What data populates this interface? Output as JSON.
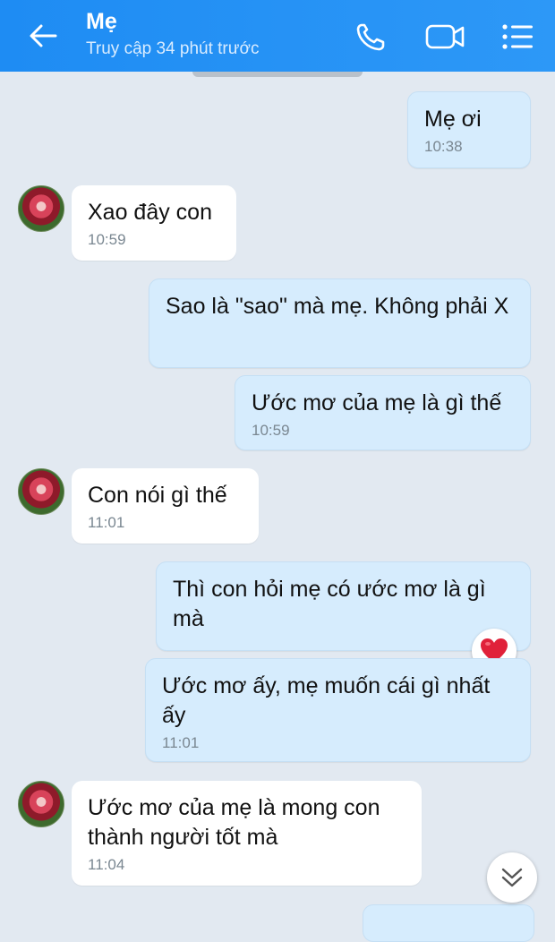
{
  "header": {
    "contact_name": "Mẹ",
    "status": "Truy cập 34 phút trước",
    "back_icon": "back-arrow-icon",
    "call_icon": "phone-icon",
    "video_icon": "video-camera-icon",
    "menu_icon": "list-menu-icon",
    "background": "#1e8cf3"
  },
  "messages": [
    {
      "sender": "me",
      "text": "Mẹ ơi",
      "time": "10:38"
    },
    {
      "sender": "them",
      "text": "Xao đây con",
      "time": "10:59"
    },
    {
      "sender": "me",
      "text": "Sao là \"sao\" mà mẹ. Không phải X",
      "time": ""
    },
    {
      "sender": "me",
      "text": "Ước mơ của mẹ là gì thế",
      "time": "10:59"
    },
    {
      "sender": "them",
      "text": "Con nói gì thế",
      "time": "11:01"
    },
    {
      "sender": "me",
      "text": "Thì con hỏi mẹ có ước mơ là gì mà",
      "time": "",
      "reaction": "heart"
    },
    {
      "sender": "me",
      "text": "Ước mơ ấy, mẹ muốn cái gì nhất ấy",
      "time": "11:01"
    },
    {
      "sender": "them",
      "text": "Ước mơ của mẹ là mong con thành người tốt mà",
      "time": "11:04"
    }
  ],
  "colors": {
    "my_bubble": "#d6ecfd",
    "their_bubble": "#ffffff",
    "chat_background": "#e2e9f1",
    "reaction_heart": "#e0213a"
  },
  "controls": {
    "scroll_down_icon": "double-chevron-down-icon"
  }
}
